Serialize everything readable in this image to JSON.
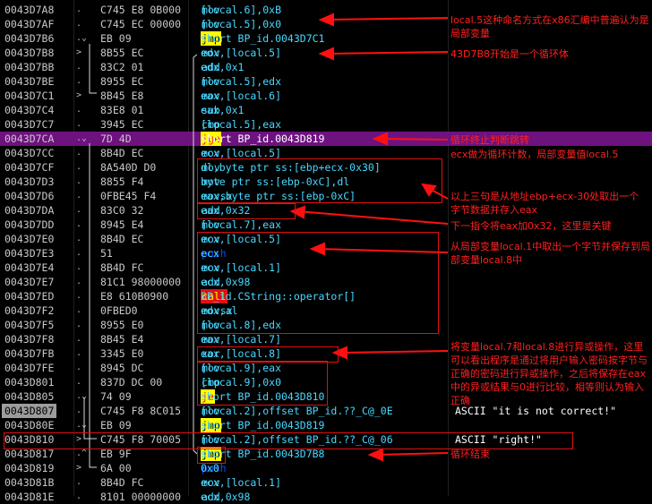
{
  "rows": [
    {
      "addr": "0043D7A8",
      "mark": ".",
      "hex": "C745 E8 0B000",
      "op": "mov",
      "kw": "mov",
      "args": " [local.6],0xB",
      "cmt": ""
    },
    {
      "addr": "0043D7AF",
      "mark": ".",
      "hex": "C745 EC 00000",
      "op": "mov",
      "kw": "mov",
      "args": " [local.5],0x0",
      "cmt": ""
    },
    {
      "addr": "0043D7B6",
      "mark": ".⌄",
      "hex": "EB 09",
      "op": "jmp",
      "kw": "jmp",
      "args": " short BP_id.0043D7C1",
      "cmt": ""
    },
    {
      "addr": "0043D7B8",
      "mark": ">",
      "hex": "8B55 EC",
      "op": "mov",
      "kw": "mov",
      "args": " edx,[local.5]",
      "cmt": ""
    },
    {
      "addr": "0043D7BB",
      "mark": ".",
      "hex": "83C2 01",
      "op": "add",
      "kw": "mov",
      "args": " edx,0x1",
      "cmt": ""
    },
    {
      "addr": "0043D7BE",
      "mark": ".",
      "hex": "8955 EC",
      "op": "mov",
      "kw": "mov",
      "args": " [local.5],edx",
      "cmt": ""
    },
    {
      "addr": "0043D7C1",
      "mark": ">",
      "hex": "8B45 E8",
      "op": "mov",
      "kw": "mov",
      "args": " eax,[local.6]",
      "cmt": ""
    },
    {
      "addr": "0043D7C4",
      "mark": ".",
      "hex": "83E8 01",
      "op": "sub",
      "kw": "mov",
      "args": " eax,0x1",
      "cmt": ""
    },
    {
      "addr": "0043D7C7",
      "mark": ".",
      "hex": "3945 EC",
      "op": "cmp",
      "kw": "mov",
      "args": " [local.5],eax",
      "cmt": ""
    },
    {
      "addr": "0043D7CA",
      "mark": ".⌄",
      "hex": "7D 4D",
      "op": "jge",
      "kw": "jcc",
      "args": " short BP_id.0043D819",
      "cmt": ""
    },
    {
      "addr": "0043D7CC",
      "mark": ".",
      "hex": "8B4D EC",
      "op": "mov",
      "kw": "mov",
      "args": " ecx,[local.5]",
      "cmt": ""
    },
    {
      "addr": "0043D7CF",
      "mark": ".",
      "hex": "8A540D D0",
      "op": "mov",
      "kw": "mov",
      "args": " dl,byte ptr ss:[ebp+ecx-0x30]",
      "cmt": ""
    },
    {
      "addr": "0043D7D3",
      "mark": ".",
      "hex": "8855 F4",
      "op": "mov",
      "kw": "mov",
      "args": " byte ptr ss:[ebp-0xC],dl",
      "cmt": ""
    },
    {
      "addr": "0043D7D6",
      "mark": ".",
      "hex": "0FBE45 F4",
      "op": "movsx",
      "kw": "mov",
      "args": " eax,byte ptr ss:[ebp-0xC]",
      "cmt": ""
    },
    {
      "addr": "0043D7DA",
      "mark": ".",
      "hex": "83C0 32",
      "op": "add",
      "kw": "mov",
      "args": " eax,0x32",
      "cmt": ""
    },
    {
      "addr": "0043D7DD",
      "mark": ".",
      "hex": "8945 E4",
      "op": "mov",
      "kw": "mov",
      "args": " [local.7],eax",
      "cmt": ""
    },
    {
      "addr": "0043D7E0",
      "mark": ".",
      "hex": "8B4D EC",
      "op": "mov",
      "kw": "mov",
      "args": " ecx,[local.5]",
      "cmt": ""
    },
    {
      "addr": "0043D7E3",
      "mark": ".",
      "hex": "51",
      "op": "push",
      "kw": "push",
      "args": " ecx",
      "cmt": ""
    },
    {
      "addr": "0043D7E4",
      "mark": ".",
      "hex": "8B4D FC",
      "op": "mov",
      "kw": "mov",
      "args": " ecx,[local.1]",
      "cmt": ""
    },
    {
      "addr": "0043D7E7",
      "mark": ".",
      "hex": "81C1 98000000",
      "op": "add",
      "kw": "mov",
      "args": " ecx,0x98",
      "cmt": ""
    },
    {
      "addr": "0043D7ED",
      "mark": ".",
      "hex": "E8 610B0900",
      "op": "call",
      "kw": "call",
      "args": " BP_id.CString::operator[]",
      "cmt": ""
    },
    {
      "addr": "0043D7F2",
      "mark": ".",
      "hex": "0FBED0",
      "op": "movsx",
      "kw": "mov",
      "args": " edx,al",
      "cmt": ""
    },
    {
      "addr": "0043D7F5",
      "mark": ".",
      "hex": "8955 E0",
      "op": "mov",
      "kw": "mov",
      "args": " [local.8],edx",
      "cmt": ""
    },
    {
      "addr": "0043D7F8",
      "mark": ".",
      "hex": "8B45 E4",
      "op": "mov",
      "kw": "mov",
      "args": " eax,[local.7]",
      "cmt": ""
    },
    {
      "addr": "0043D7FB",
      "mark": ".",
      "hex": "3345 E0",
      "op": "xor",
      "kw": "mov",
      "args": " eax,[local.8]",
      "cmt": ""
    },
    {
      "addr": "0043D7FE",
      "mark": ".",
      "hex": "8945 DC",
      "op": "mov",
      "kw": "mov",
      "args": " [local.9],eax",
      "cmt": ""
    },
    {
      "addr": "0043D801",
      "mark": ".",
      "hex": "837D DC 00",
      "op": "cmp",
      "kw": "mov",
      "args": " [local.9],0x0",
      "cmt": ""
    },
    {
      "addr": "0043D805",
      "mark": ".⌄",
      "hex": "74 09",
      "op": "je",
      "kw": "jcc",
      "args": " short BP_id.0043D810",
      "cmt": ""
    },
    {
      "addr": "0043D807",
      "mark": ".",
      "hex": "C745 F8 8C015",
      "op": "mov",
      "kw": "mov",
      "args": " [local.2],offset BP_id.??_C@_0E",
      "cmt": "ASCII \"it is not correct!\""
    },
    {
      "addr": "0043D80E",
      "mark": ".⌄",
      "hex": "EB 09",
      "op": "jmp",
      "kw": "jmp",
      "args": " short BP_id.0043D819",
      "cmt": ""
    },
    {
      "addr": "0043D810",
      "mark": ">",
      "hex": "C745 F8 70005",
      "op": "mov",
      "kw": "mov",
      "args": " [local.2],offset BP_id.??_C@_06",
      "cmt": "ASCII \"right!\""
    },
    {
      "addr": "0043D817",
      "mark": ".^",
      "hex": "EB 9F",
      "op": "jmp",
      "kw": "jmp",
      "args": " short BP_id.0043D7B8",
      "cmt": ""
    },
    {
      "addr": "0043D819",
      "mark": ">",
      "hex": "6A 00",
      "op": "push",
      "kw": "push",
      "args": " 0x0",
      "cmt": ""
    },
    {
      "addr": "0043D81B",
      "mark": ".",
      "hex": "8B4D FC",
      "op": "mov",
      "kw": "mov",
      "args": " ecx,[local.1]",
      "cmt": ""
    },
    {
      "addr": "0043D81E",
      "mark": ".",
      "hex": "8101 00000000",
      "op": "add",
      "kw": "mov",
      "args": " ecx,0x98",
      "cmt": ""
    }
  ],
  "annotations": [
    "local.5这种命名方式在x86汇编中普遍认为是局部变量",
    "43D7B8开始是一个循环体",
    "循环终止判断跳转",
    "ecx做为循环计数，局部变量值local.5",
    "以上三句是从地址ebp+ecx-30处取出一个字节数据并存入eax",
    "下一指令将eax加0x32，这里是关键",
    "从局部变量local.1中取出一个字节并保存到局部变量local.8中",
    "将变量local.7和local.8进行异或操作，这里可以看出程序是通过将用户输入密码按字节与正确的密码进行异或操作，之后将保存在eax中的异或结果与0进行比较，相等则认为输入正确",
    "循环结束"
  ]
}
